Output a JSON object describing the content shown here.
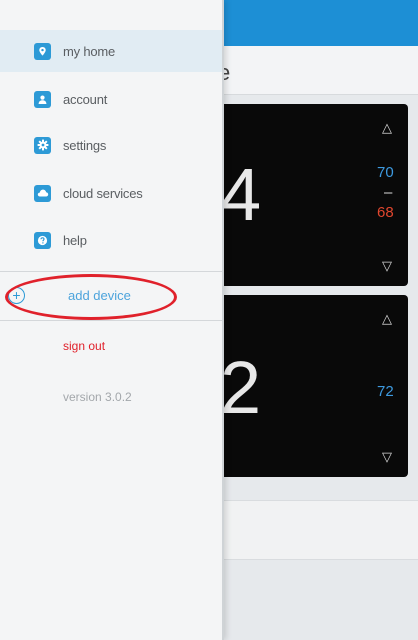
{
  "background": {
    "title_fragment": "e",
    "devices": [
      {
        "temperature": "4",
        "cool_setpoint": "70",
        "dash": "–",
        "heat_setpoint": "68",
        "up_arrow": "△",
        "down_arrow": "▽"
      },
      {
        "temperature": "2",
        "cool_setpoint": "72",
        "up_arrow": "△",
        "down_arrow": "▽"
      }
    ]
  },
  "drawer": {
    "menu": [
      {
        "label": "my home",
        "icon": "location-pin-icon"
      },
      {
        "label": "account",
        "icon": "person-icon"
      },
      {
        "label": "settings",
        "icon": "gear-icon"
      },
      {
        "label": "cloud services",
        "icon": "cloud-icon"
      },
      {
        "label": "help",
        "icon": "question-icon"
      }
    ],
    "add_device": {
      "label": "add device",
      "icon": "plus-circle-icon"
    },
    "sign_out": "sign out",
    "version": "version 3.0.2"
  },
  "colors": {
    "accent": "#2d9ad6",
    "header": "#1d8fd5",
    "danger": "#e0212b",
    "cool": "#3d9ae0",
    "heat": "#e0462e"
  }
}
